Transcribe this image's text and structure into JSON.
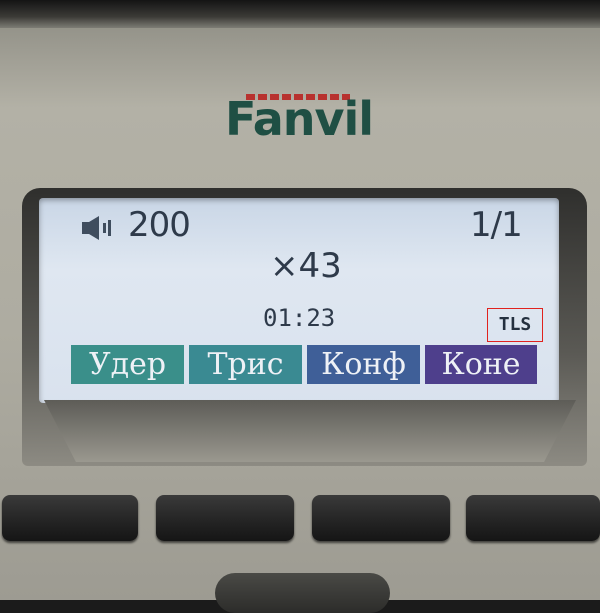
{
  "brand": {
    "name": "Fanvil",
    "color": "#1f4f44",
    "accent": "#b8322f"
  },
  "status": {
    "speaker_icon": "speaker-icon",
    "line_number": "200",
    "line_count": "1/1"
  },
  "call": {
    "callee": "×43",
    "duration": "01:23",
    "security": "TLS"
  },
  "softkeys": [
    {
      "label": "Удер",
      "color": "#3a8f8a"
    },
    {
      "label": "Трис",
      "color": "#3a8a92"
    },
    {
      "label": "Конф",
      "color": "#3f5f98"
    },
    {
      "label": "Коне",
      "color": "#4e3f8c"
    }
  ],
  "colors": {
    "lcd_background": "#d9e2ee",
    "lcd_text": "#2e3a4a",
    "highlight_box": "#e0221e"
  }
}
